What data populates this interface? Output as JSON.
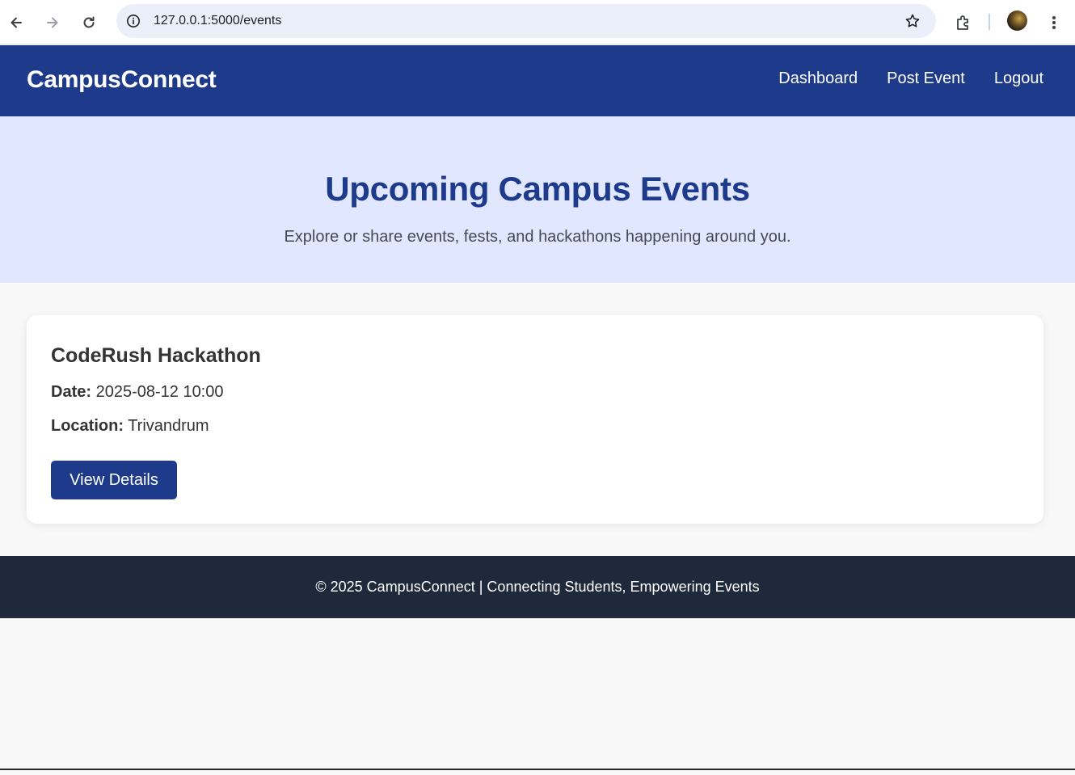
{
  "browser": {
    "url": "127.0.0.1:5000/events"
  },
  "header": {
    "brand": "CampusConnect",
    "nav": [
      "Dashboard",
      "Post Event",
      "Logout"
    ]
  },
  "hero": {
    "title": "Upcoming Campus Events",
    "subtitle": "Explore or share events, fests, and hackathons happening around you."
  },
  "events": [
    {
      "title": "CodeRush Hackathon",
      "date_label": "Date:",
      "date": "2025-08-12 10:00",
      "location_label": "Location:",
      "location": "Trivandrum",
      "button": "View Details"
    }
  ],
  "footer": {
    "text": "© 2025 CampusConnect | Connecting Students, Empowering Events"
  },
  "colors": {
    "primary": "#1e3a8a",
    "hero_bg": "#e0e7ff",
    "footer_bg": "#1e293b"
  },
  "icons": [
    "back-arrow-icon",
    "forward-arrow-icon",
    "reload-icon",
    "site-info-icon",
    "bookmark-star-icon",
    "extensions-icon",
    "profile-avatar",
    "more-menu-icon"
  ]
}
